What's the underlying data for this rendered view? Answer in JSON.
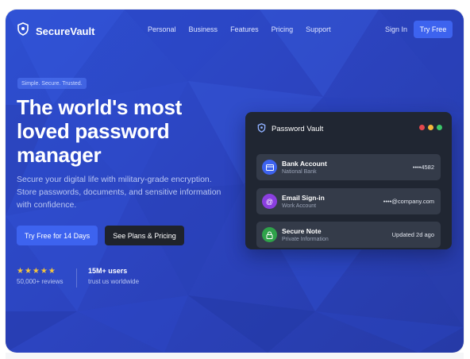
{
  "nav": {
    "brand": "SecureVault",
    "links": [
      "Personal",
      "Business",
      "Features",
      "Pricing",
      "Support"
    ],
    "signin": "Sign In",
    "try_free": "Try Free"
  },
  "hero": {
    "tagline": "Simple. Secure. Trusted.",
    "headline": "The world's most loved password manager",
    "subtext": "Secure your digital life with military-grade encryption. Store passwords, documents, and sensitive information with confidence.",
    "primary_cta": "Try Free for 14 Days",
    "secondary_cta": "See Plans & Pricing",
    "rating_stars": "★★★★★",
    "reviews": "50,000+ reviews",
    "users_count": "15M+ users",
    "users_sub": "trust us worldwide"
  },
  "vault": {
    "title": "Password Vault",
    "window_dots": [
      "#e5484d",
      "#f5b73b",
      "#3cc76a"
    ],
    "items": [
      {
        "name": "Bank Account",
        "sub": "National Bank",
        "value": "••••4582",
        "icon": "card-icon",
        "color": "#3d63ef"
      },
      {
        "name": "Email Sign-in",
        "sub": "Work Account",
        "value": "••••@company.com",
        "icon": "at-icon",
        "color": "#8b3fe0"
      },
      {
        "name": "Secure Note",
        "sub": "Private Information",
        "value": "Updated 2d ago",
        "icon": "lock-icon",
        "color": "#2fa24a"
      }
    ]
  },
  "colors": {
    "accent": "#3d63ef",
    "background": "#2c44c0",
    "card": "#202632"
  }
}
